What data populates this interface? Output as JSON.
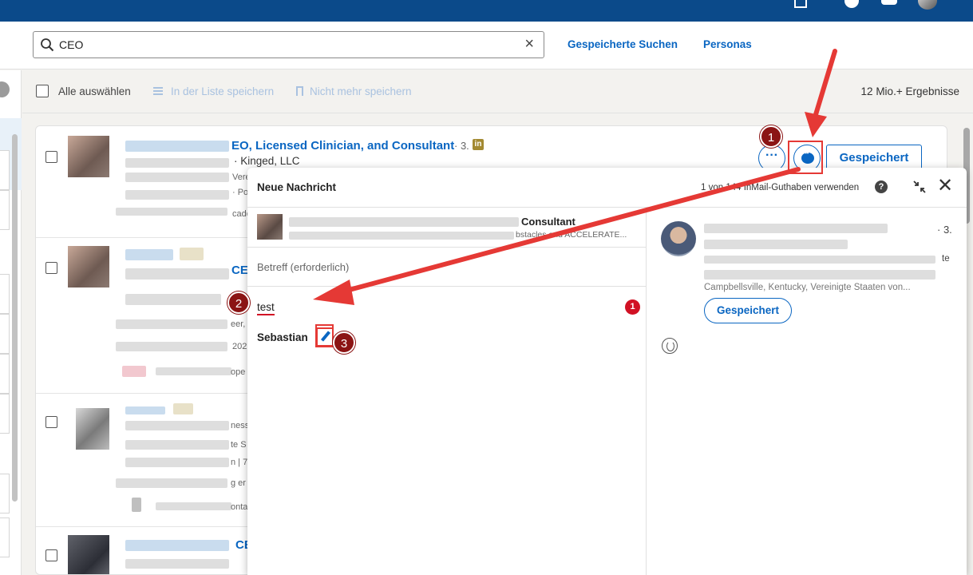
{
  "search": {
    "value": "CEO",
    "clear_symbol": "×"
  },
  "nav": {
    "saved_searches": "Gespeicherte Suchen",
    "personas": "Personas"
  },
  "toolbar": {
    "select_all": "Alle auswählen",
    "save_to_list": "In der Liste speichern",
    "unsave": "Nicht mehr speichern",
    "result_count": "12 Mio.+ Ergebnisse"
  },
  "result1": {
    "title": "EO, Licensed Clinician, and Consultant",
    "degree": "· 3.",
    "badge": "in",
    "company": "· Kinged, LLC",
    "fragments": [
      "Vere",
      "· Po",
      "cade"
    ],
    "more_label": "···",
    "saved_label": "Gespeichert"
  },
  "result2": {
    "title_fragment": "CEI",
    "fragments": [
      "eer,",
      "202",
      "ope"
    ]
  },
  "result3": {
    "fragments": [
      "ness",
      "te S",
      "n | 7",
      "g er",
      "onta"
    ]
  },
  "result4": {
    "title_fragment": "CE"
  },
  "dialog": {
    "title": "Neue Nachricht",
    "credits": "1 von 144 InMail-Guthaben verwenden",
    "help_symbol": "?",
    "close_symbol": "✕",
    "recipient_name": "Consultant",
    "recipient_sub": "bstacles and ACCELERATE...",
    "subject_placeholder": "Betreff (erforderlich)",
    "body": "test",
    "error_count": "1",
    "signature": "Sebastian"
  },
  "profile": {
    "degree": "· 3.",
    "fragment_te": "te",
    "location_fragment": "Campbellsville, Kentucky, Vereinigte Staaten von...",
    "saved_label": "Gespeichert"
  },
  "annotations": {
    "step1": "1",
    "step2": "2",
    "step3": "3"
  },
  "colors": {
    "brand_blue": "#0a66c2",
    "topbar": "#0b4a8a",
    "annotation_red": "#e53935",
    "badge_dark_red": "#8b1414"
  }
}
